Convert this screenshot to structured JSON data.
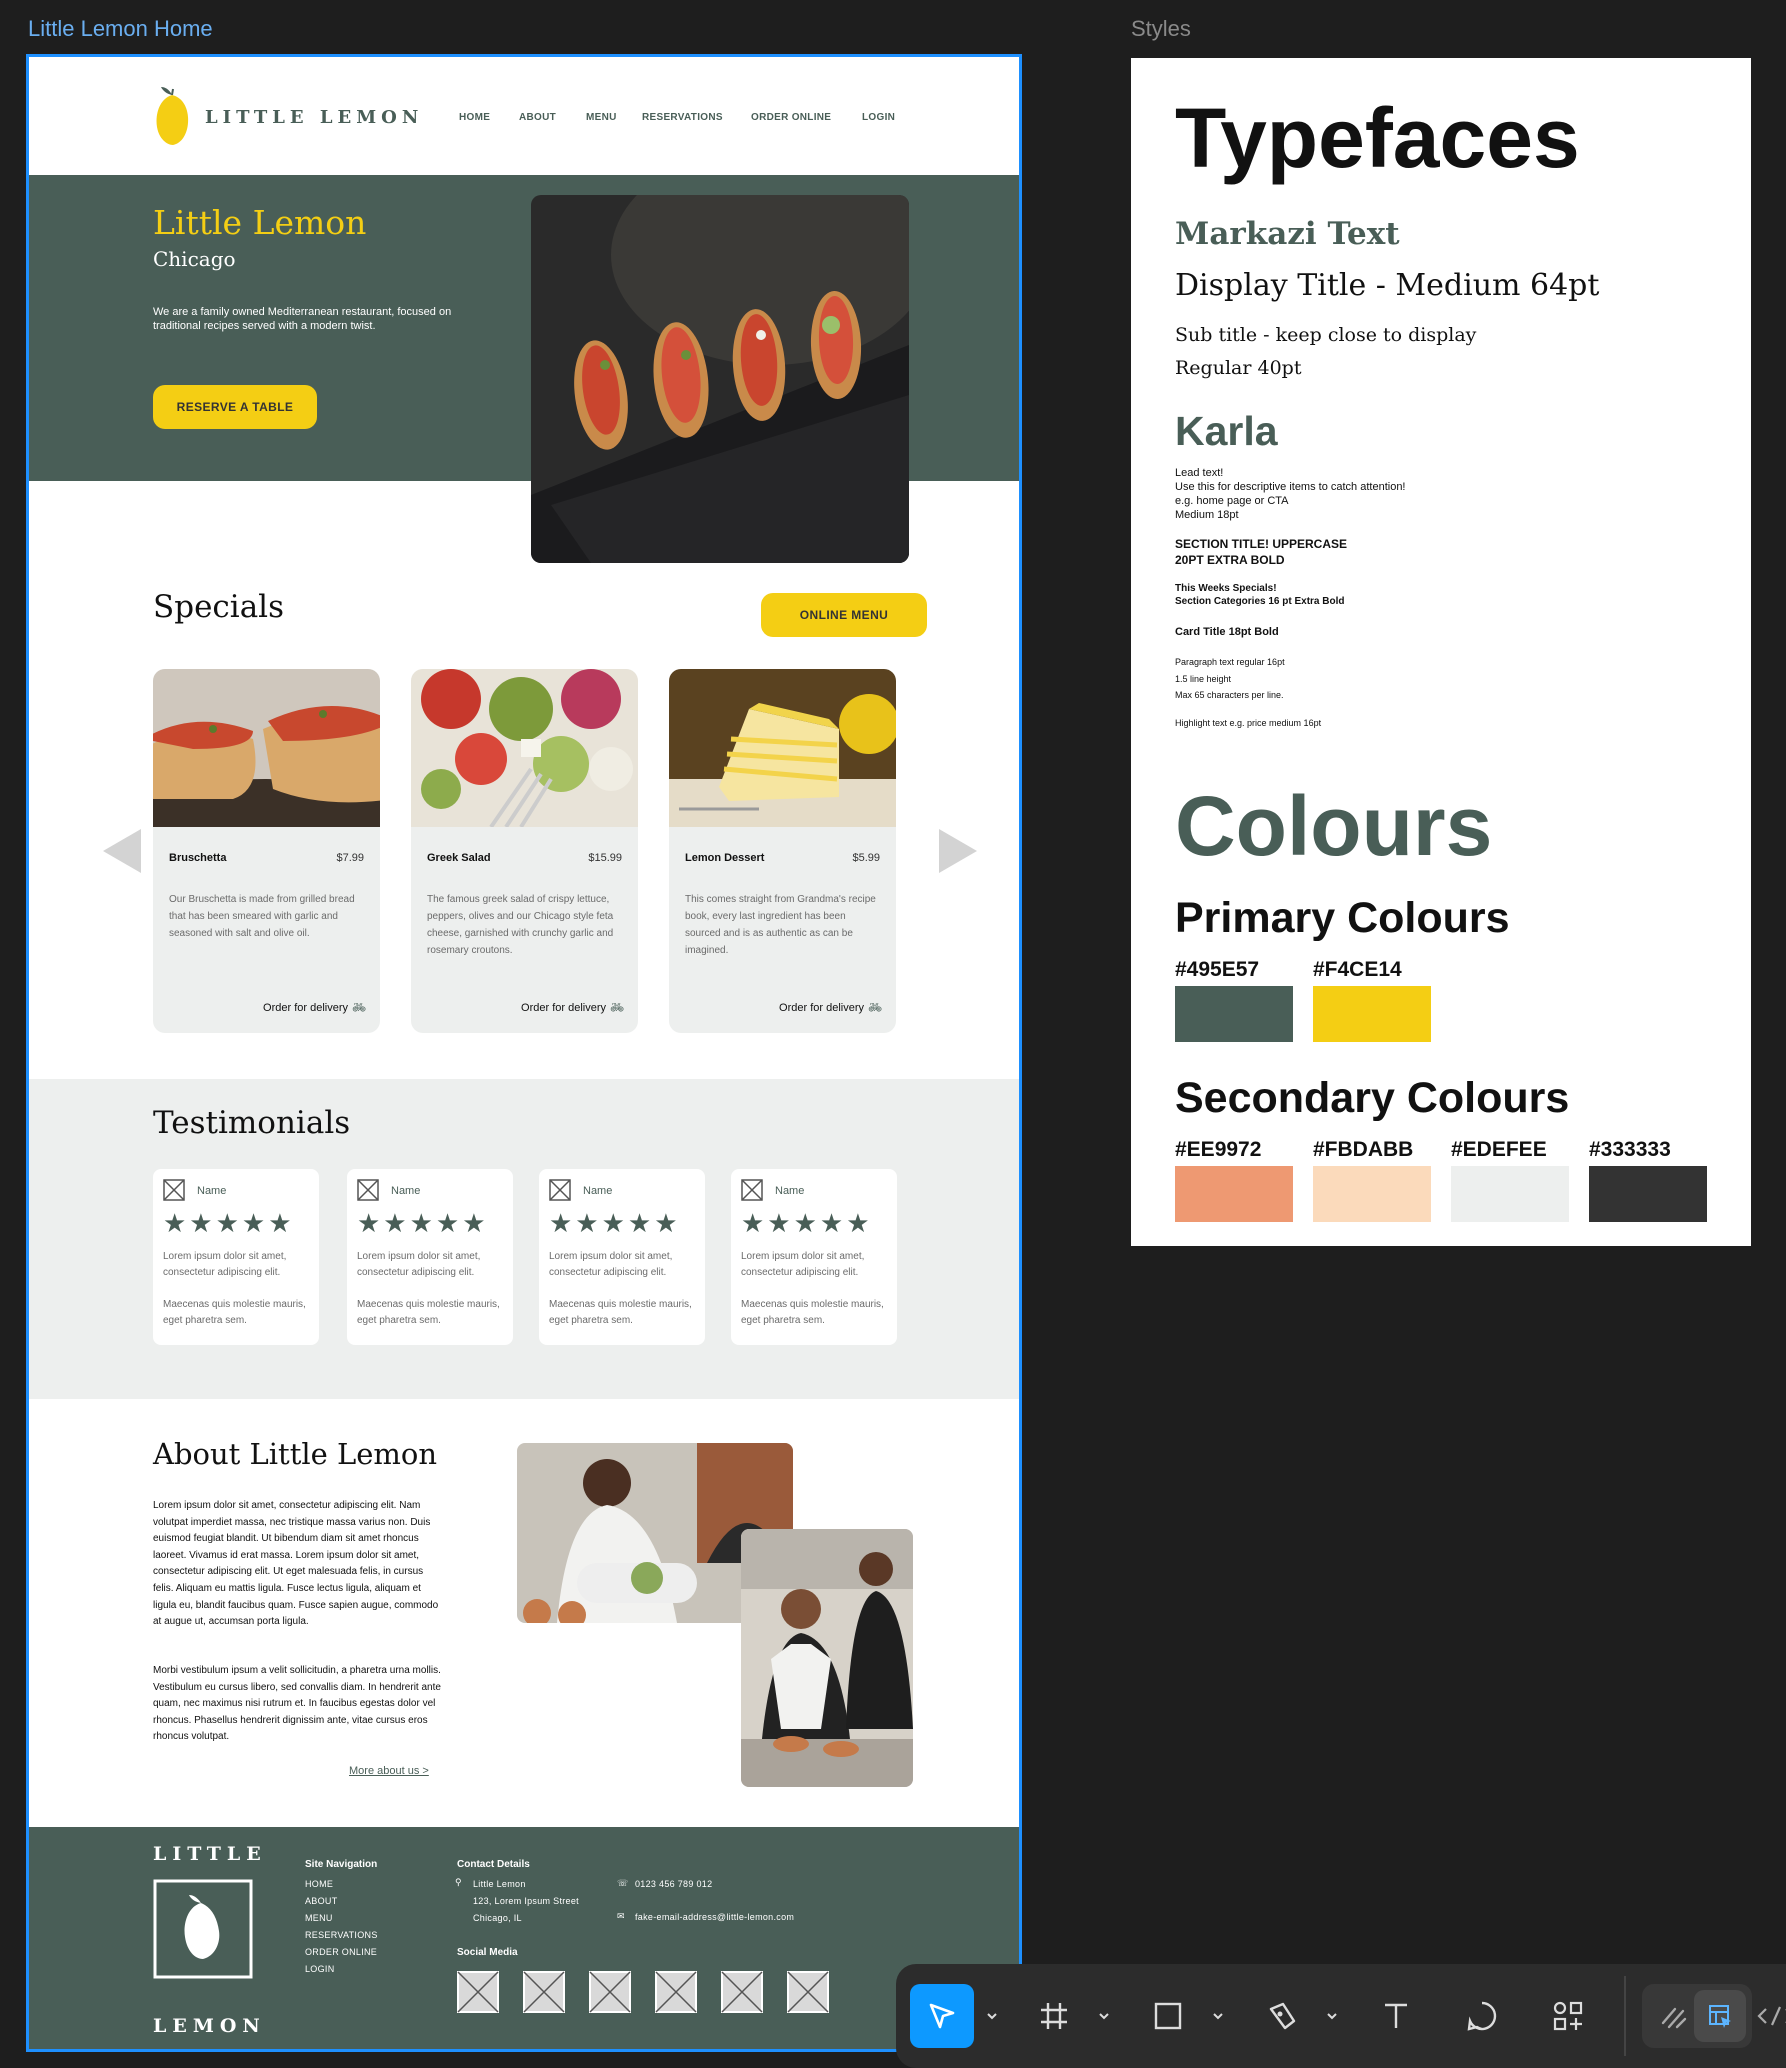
{
  "canvas": {
    "frame_label": "Little Lemon Home",
    "styles_label": "Styles"
  },
  "header": {
    "logo_text": "LITTLE LEMON",
    "nav": [
      "HOME",
      "ABOUT",
      "MENU",
      "RESERVATIONS",
      "ORDER ONLINE",
      "LOGIN"
    ]
  },
  "hero": {
    "title": "Little Lemon",
    "subtitle": "Chicago",
    "description": "We are a family owned Mediterranean restaurant, focused on traditional recipes served with a modern twist.",
    "cta": "RESERVE A TABLE"
  },
  "specials": {
    "title": "Specials",
    "menu_button": "ONLINE MENU",
    "cards": [
      {
        "title": "Bruschetta",
        "price": "$7.99",
        "description": "Our Bruschetta is made from grilled bread that has been smeared with garlic and seasoned with salt and olive oil.",
        "order": "Order for delivery"
      },
      {
        "title": "Greek Salad",
        "price": "$15.99",
        "description": "The famous greek salad of crispy lettuce, peppers, olives and our Chicago style feta cheese, garnished with crunchy garlic and rosemary croutons.",
        "order": "Order for delivery"
      },
      {
        "title": "Lemon Dessert",
        "price": "$5.99",
        "description": "This comes straight from Grandma's recipe book, every last ingredient has been sourced and is as authentic as can be imagined.",
        "order": "Order for delivery"
      }
    ]
  },
  "testimonials": {
    "title": "Testimonials",
    "items": [
      {
        "name": "Name",
        "stars": "★★★★★",
        "text1": "Lorem ipsum dolor sit amet, consectetur adipiscing elit.",
        "text2": "Maecenas quis  molestie mauris, eget pharetra sem."
      },
      {
        "name": "Name",
        "stars": "★★★★★",
        "text1": "Lorem ipsum dolor sit amet, consectetur adipiscing elit.",
        "text2": "Maecenas quis  molestie mauris, eget pharetra sem."
      },
      {
        "name": "Name",
        "stars": "★★★★★",
        "text1": "Lorem ipsum dolor sit amet, consectetur adipiscing elit.",
        "text2": "Maecenas quis  molestie mauris, eget pharetra sem."
      },
      {
        "name": "Name",
        "stars": "★★★★★",
        "text1": "Lorem ipsum dolor sit amet, consectetur adipiscing elit.",
        "text2": "Maecenas quis  molestie mauris, eget pharetra sem."
      }
    ]
  },
  "about": {
    "title": "About Little Lemon",
    "p1": "Lorem ipsum dolor sit amet, consectetur adipiscing elit. Nam volutpat  imperdiet massa, nec tristique massa varius non. Duis euismod feugiat  blandit. Ut bibendum diam sit amet rhoncus laoreet. Vivamus id erat  massa. Lorem ipsum dolor sit amet, consectetur adipiscing elit. Ut eget  malesuada felis, in cursus felis. Aliquam eu mattis ligula. Fusce lectus ligula, aliquam et ligula eu, blandit faucibus quam. Fusce sapien  augue, commodo at augue ut, accumsan porta ligula.",
    "p2": "Morbi vestibulum ipsum a velit sollicitudin, a pharetra urna mollis.  Vestibulum eu cursus libero, sed convallis diam. In hendrerit ante quam, nec maximus nisi rutrum et. In faucibus egestas dolor vel rhoncus.  Phasellus hendrerit dignissim ante, vitae cursus eros rhoncus volutpat.",
    "link": "More about us >"
  },
  "footer": {
    "logo_top": "LITTLE",
    "logo_bottom": "LEMON",
    "nav_title": "Site Navigation",
    "nav": [
      "HOME",
      "ABOUT",
      "MENU",
      "RESERVATIONS",
      "ORDER ONLINE",
      "LOGIN"
    ],
    "contact_title": "Contact Details",
    "address": [
      "Little Lemon",
      "123, Lorem Ipsum Street",
      "Chicago,  IL"
    ],
    "phone": "0123 456 789 012",
    "email": "fake-email-address@little-lemon.com",
    "social_title": "Social Media"
  },
  "styles": {
    "typefaces_title": "Typefaces",
    "markazi_name": "Markazi Text",
    "display_title": "Display Title - Medium 64pt",
    "sub_title_1": "Sub title - keep close to display",
    "sub_title_2": "Regular 40pt",
    "karla_name": "Karla",
    "lead_lines": [
      "Lead text!",
      "Use this for descriptive items to catch attention!",
      "e.g. home page or CTA",
      "Medium 18pt"
    ],
    "section_title_lines": [
      "SECTION TITLE! UPPERCASE",
      "20PT EXTRA BOLD"
    ],
    "section_cat_lines": [
      "This Weeks Specials!",
      "Section Categories 16 pt Extra Bold"
    ],
    "card_title": "Card Title 18pt Bold",
    "paragraph_lines": [
      "Paragraph text regular 16pt",
      "1.5 line height",
      "Max 65 characters per line."
    ],
    "highlight": "Highlight text e.g. price medium 16pt",
    "colours_title": "Colours",
    "primary_title": "Primary Colours",
    "primary": [
      {
        "hex": "#495E57",
        "color": "#495e57"
      },
      {
        "hex": "#F4CE14",
        "color": "#f4ce14"
      }
    ],
    "secondary_title": "Secondary Colours",
    "secondary": [
      {
        "hex": "#EE9972",
        "color": "#ee9972"
      },
      {
        "hex": "#FBDABB",
        "color": "#fbdabb"
      },
      {
        "hex": "#EDEFEE",
        "color": "#edefee"
      },
      {
        "hex": "#333333",
        "color": "#333333"
      }
    ]
  },
  "toolbar": {
    "tools": [
      "move-tool",
      "frame-tool",
      "shape-tool",
      "pen-tool",
      "text-tool",
      "comment-tool",
      "components-tool",
      "draw-mode",
      "design-mode",
      "dev-mode"
    ],
    "active": "move-tool"
  },
  "colors": {
    "primary_green": "#495e57",
    "primary_yellow": "#f4ce14",
    "selection_blue": "#1e90ff"
  }
}
